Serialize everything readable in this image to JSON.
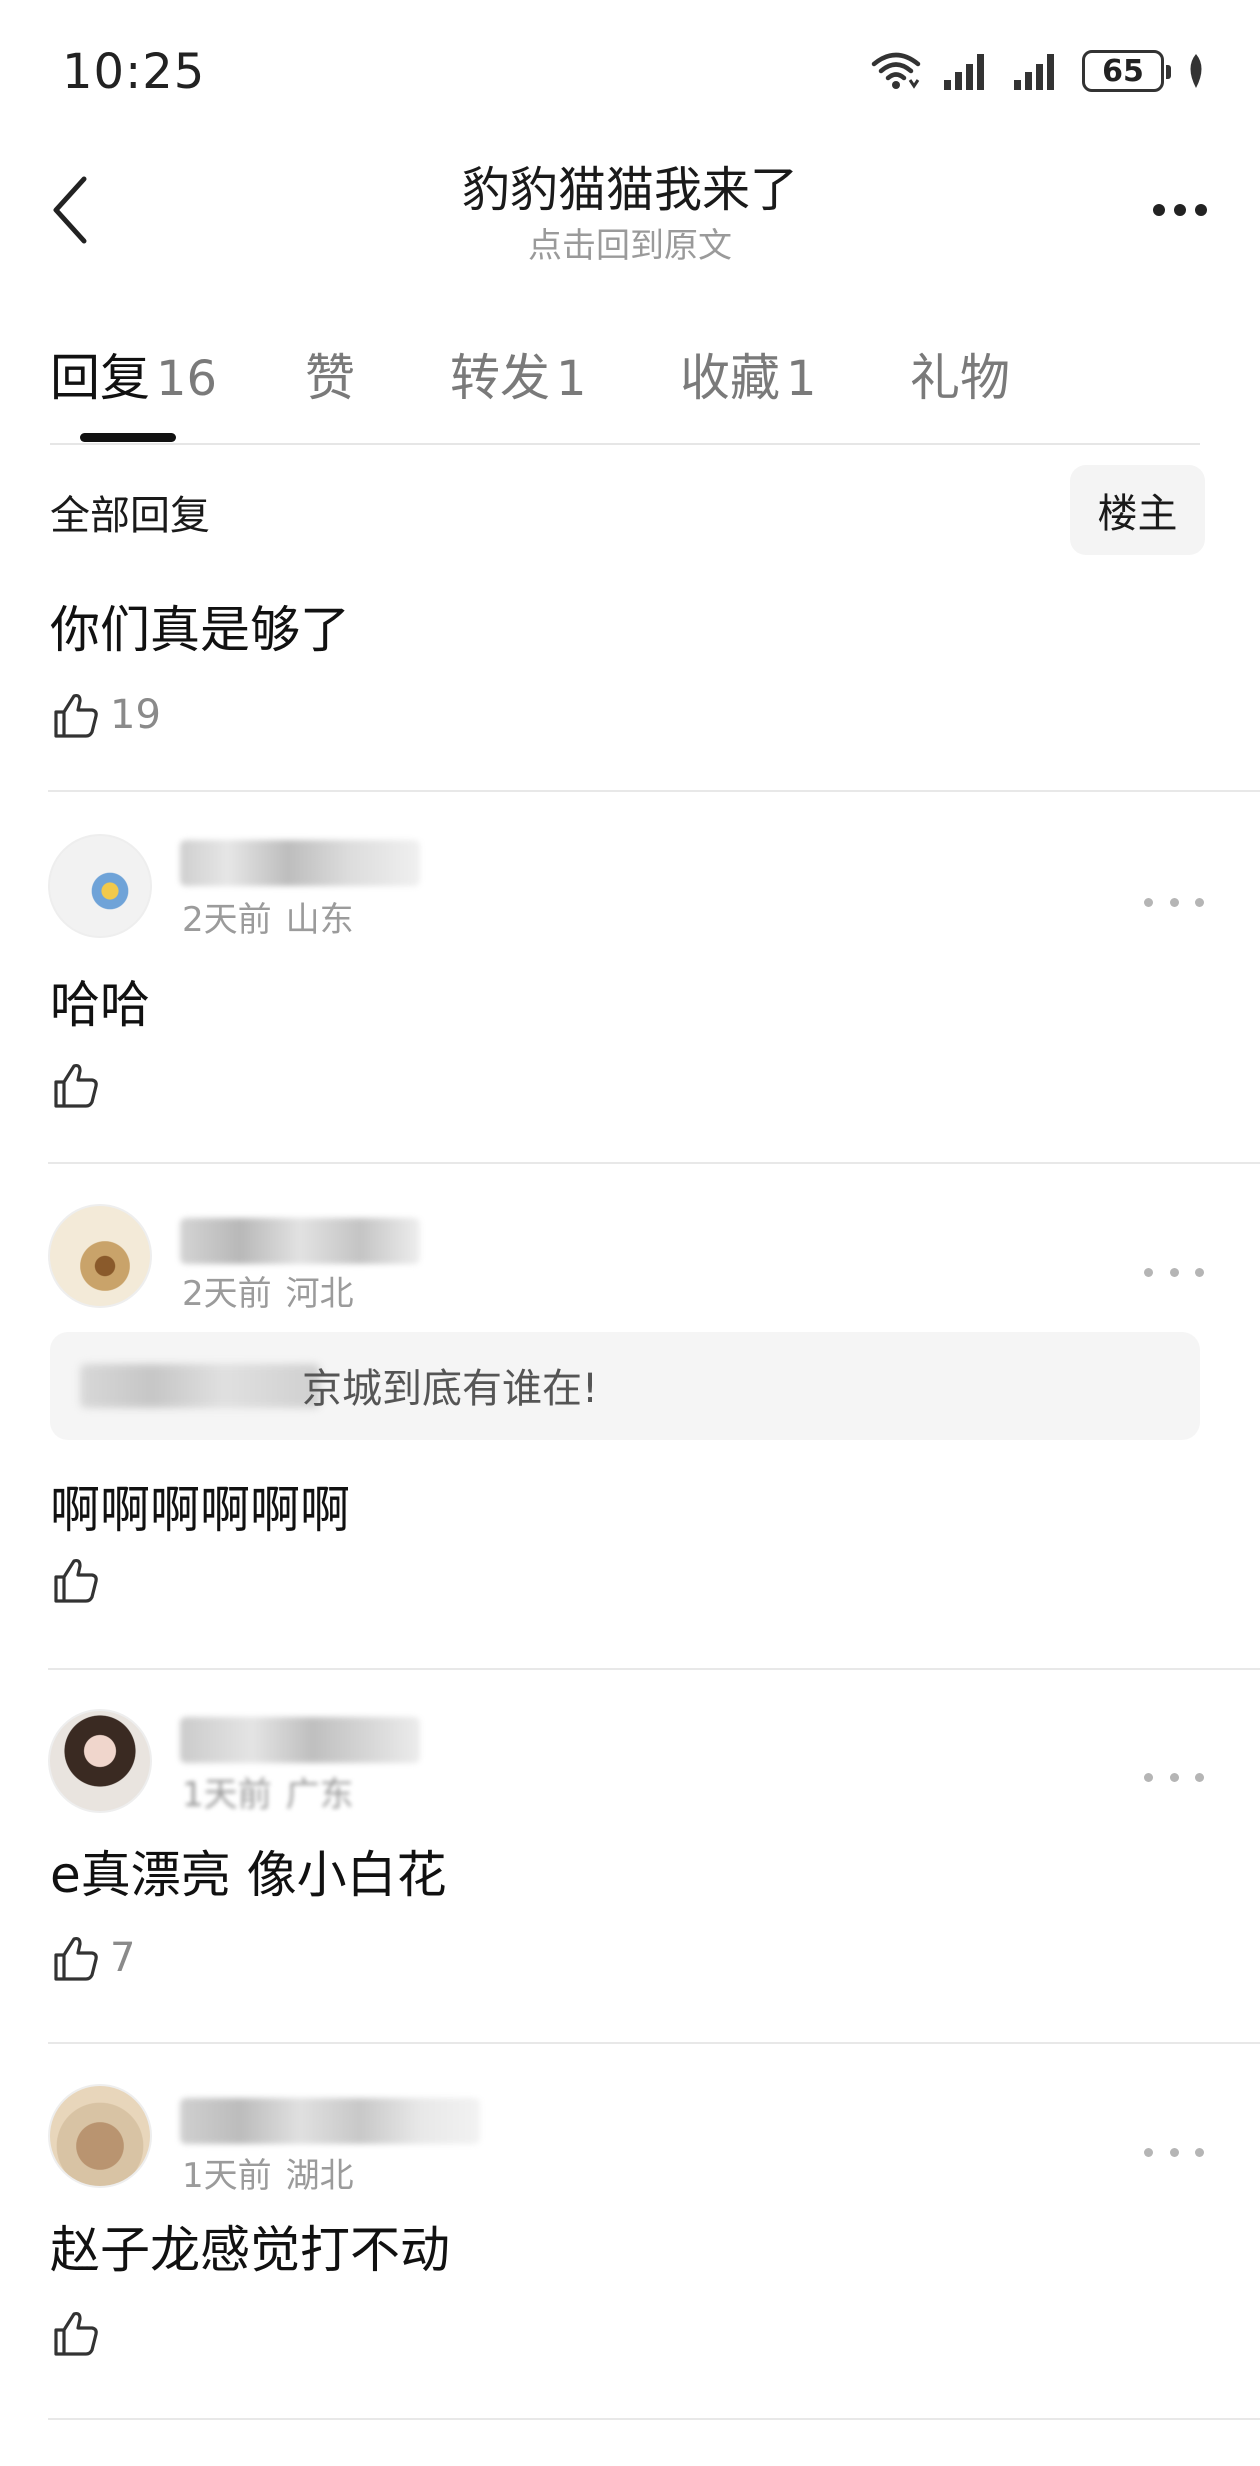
{
  "status_bar": {
    "time": "10:25",
    "battery": "65"
  },
  "nav": {
    "title": "豹豹猫猫我来了",
    "subtitle": "点击回到原文"
  },
  "tabs": [
    {
      "label": "回复",
      "count": "16"
    },
    {
      "label": "赞",
      "count": ""
    },
    {
      "label": "转发",
      "count": "1"
    },
    {
      "label": "收藏",
      "count": "1"
    },
    {
      "label": "礼物",
      "count": ""
    }
  ],
  "filter": {
    "label": "全部回复",
    "owner_button": "楼主"
  },
  "original_post": {
    "text": "你们真是够了",
    "likes": "19"
  },
  "comments": [
    {
      "time": "2天前",
      "location": "山东",
      "text": "哈哈",
      "likes": "",
      "avatar_colors": [
        "#f2f2f2",
        "#6fa3d8",
        "#f2c94c"
      ]
    },
    {
      "time": "2天前",
      "location": "河北",
      "quote": "京城到底有谁在!",
      "text": "啊啊啊啊啊啊",
      "likes": "",
      "avatar_colors": [
        "#f3ead8",
        "#c9a36a",
        "#8a5a2b"
      ]
    },
    {
      "time": "1天前",
      "location": "广东",
      "text": "e真漂亮 像小白花",
      "likes": "7",
      "avatar_colors": [
        "#e9e4df",
        "#3a2a22",
        "#f0d6cc"
      ]
    },
    {
      "time": "1天前",
      "location": "湖北",
      "text": "赵子龙感觉打不动",
      "likes": "",
      "avatar_colors": [
        "#d8c3a4",
        "#b99470",
        "#e8d6bb"
      ]
    }
  ]
}
